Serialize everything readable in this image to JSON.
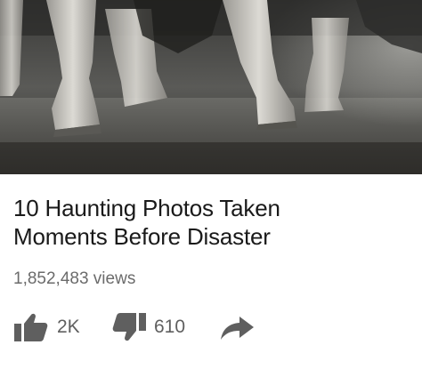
{
  "video": {
    "title_line_1": "10 Haunting Photos Taken",
    "title_line_2": "Moments Before Disaster",
    "views": "1,852,483 views"
  },
  "actions": {
    "like_count": "2K",
    "dislike_count": "610",
    "like_icon": "thumbs-up-icon",
    "dislike_icon": "thumbs-down-icon",
    "share_icon": "share-arrow-icon"
  },
  "colors": {
    "title": "#1a1a1a",
    "meta": "#6b6b6b",
    "icon": "#5f5f5f"
  }
}
